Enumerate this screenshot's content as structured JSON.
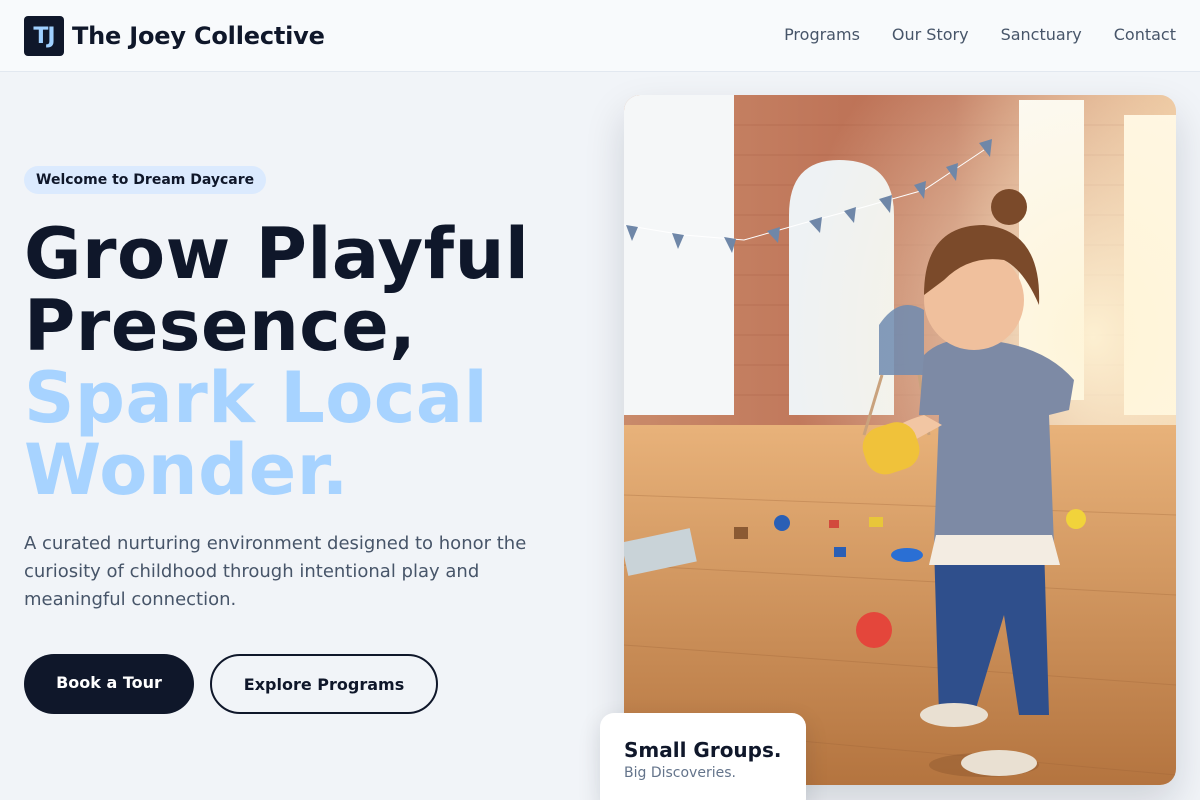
{
  "brand": {
    "mark": "TJ",
    "name": "The Joey Collective"
  },
  "nav": {
    "items": [
      "Programs",
      "Our Story",
      "Sanctuary",
      "Contact"
    ]
  },
  "hero": {
    "badge": "Welcome to Dream Daycare",
    "headline_line1": "Grow Playful",
    "headline_line2": "Presence,",
    "headline_line3": "Spark Local",
    "headline_line4": "Wonder.",
    "lead": "A curated nurturing environment designed to honor the curiosity of childhood through intentional play and meaningful connection.",
    "primary_cta": "Book a Tour",
    "secondary_cta": "Explore Programs"
  },
  "feature_card": {
    "title": "Small Groups.",
    "subtitle": "Big Discoveries."
  },
  "colors": {
    "primary": "#0f172a",
    "accent_light": "#a7d3ff",
    "badge_bg": "#dbeafe",
    "page_bg": "#f1f4f8"
  }
}
